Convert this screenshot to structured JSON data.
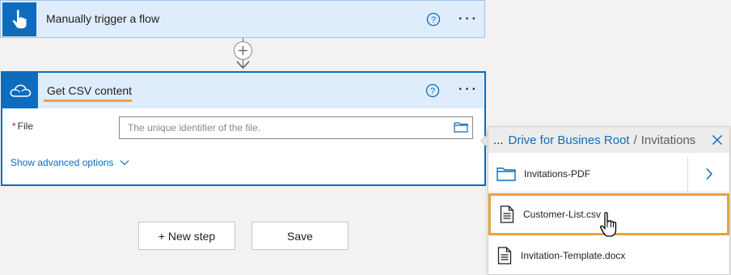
{
  "trigger": {
    "title": "Manually trigger a flow",
    "more": "···"
  },
  "action": {
    "title": "Get CSV content",
    "more": "···",
    "file_label": "File",
    "required_mark": "*",
    "file_placeholder": "The unique identifier of the file.",
    "advanced_label": "Show advanced options"
  },
  "buttons": {
    "new_step": "+ New step",
    "save": "Save"
  },
  "picker": {
    "ellipsis": "...",
    "crumb_link": "Drive for Busines Root",
    "separator": "/",
    "crumb_current": "Invitations",
    "items": [
      {
        "label": "Invitations-PDF",
        "type": "folder"
      },
      {
        "label": "Customer-List.csv",
        "type": "file",
        "selected": true
      },
      {
        "label": "Invitation-Template.docx",
        "type": "file"
      }
    ]
  },
  "colors": {
    "accent": "#0f6cbd",
    "header_bg": "#deecfb",
    "highlight": "#e8a33d",
    "required": "#a4262c"
  }
}
